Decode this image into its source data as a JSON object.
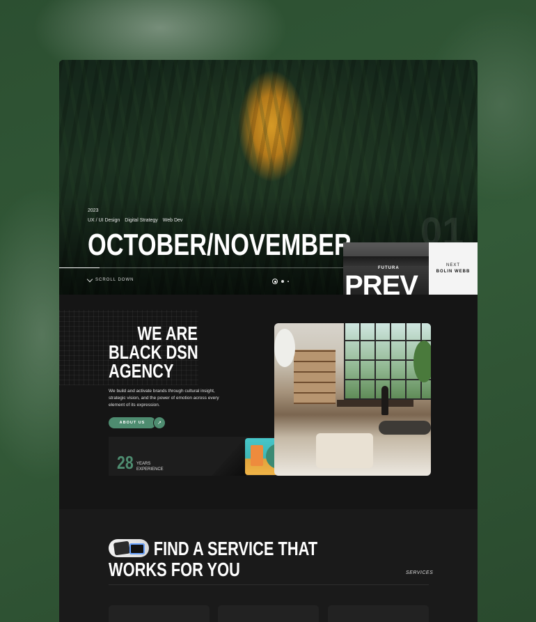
{
  "hero": {
    "year": "2023",
    "tags": [
      "UX / UI Design",
      "Digital Strategy",
      "Web Dev"
    ],
    "title": "OCTOBER/NOVEMBER",
    "slide_number": "01",
    "scroll_label": "SCROLL DOWN",
    "prev_label_small": "FUTURA",
    "prev_label_big": "PREV",
    "next_label": "NEXT",
    "next_name": "BOLIN WEBB"
  },
  "about": {
    "title_line1": "WE ARE",
    "title_line2": "BLACK DSN",
    "title_line3": "AGENCY",
    "description": "We build and activate brands through cultural insight, strategic vision, and the power of emotion across every element of its expression.",
    "button_label": "ABOUT US",
    "button_arrow": "↗",
    "years_number": "28",
    "years_label_line1": "YEARS",
    "years_label_line2": "EXPERIENCE"
  },
  "services": {
    "title_line1": "FIND A SERVICE THAT",
    "title_line2": "WORKS FOR YOU",
    "label": "SERVICES"
  },
  "colors": {
    "accent": "#4e8c70",
    "background": "#2f5434",
    "card": "#141414"
  }
}
